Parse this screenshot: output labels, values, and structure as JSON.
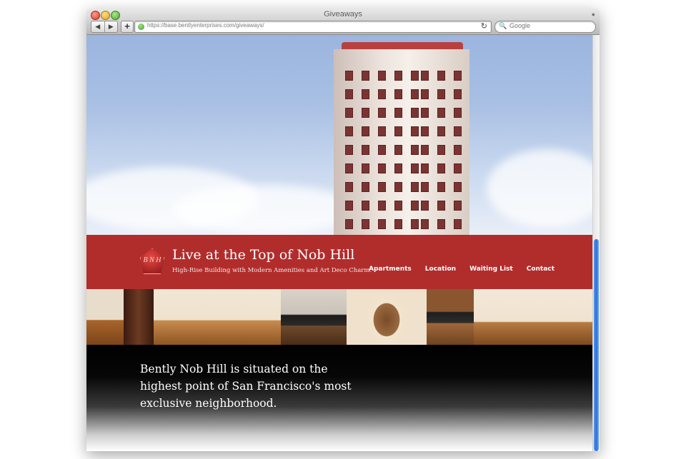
{
  "browser": {
    "window_title": "Giveaways",
    "url": "https://base.bentlyenterprises.com/giveaways/",
    "search_placeholder": "Google",
    "back_glyph": "◀",
    "forward_glyph": "▶",
    "add_glyph": "+",
    "reload_glyph": "↻",
    "icons": [
      "close-button",
      "minimize-button",
      "zoom-button",
      "lock-icon",
      "back-icon",
      "forward-icon",
      "add-bookmark-icon",
      "globe-icon",
      "reload-icon",
      "search-icon"
    ]
  },
  "site": {
    "logo_letters": "B N H",
    "title": "Live at the Top of Nob Hill",
    "tagline": "High-Rise Building with Modern Amenities and Art Deco Charm.",
    "nav": [
      {
        "label": "Apartments"
      },
      {
        "label": "Location"
      },
      {
        "label": "Waiting List"
      },
      {
        "label": "Contact"
      }
    ],
    "lead": "Bently Nob Hill is situated on the highest point of San Francisco's most exclusive neighborhood.",
    "colors": {
      "banner": "#ac201f",
      "sky": "#9bb5df",
      "main_bg": "#000000",
      "scroll_thumb": "#2b6fd8"
    }
  }
}
